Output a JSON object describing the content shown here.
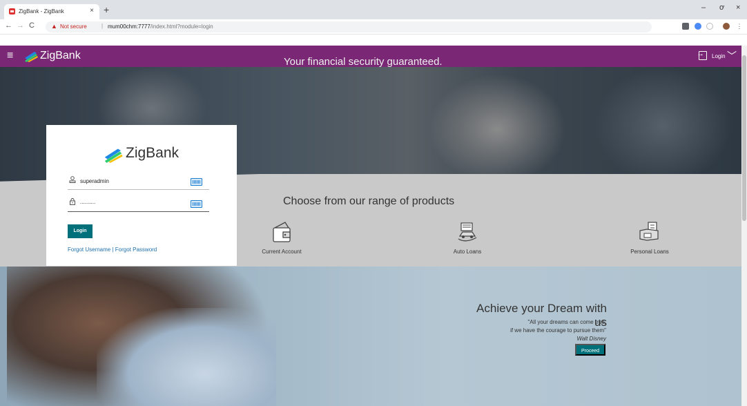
{
  "browser": {
    "tab_title": "ZigBank - ZigBank",
    "tab_close": "×",
    "new_tab": "+",
    "security_label": "Not secure",
    "url_separator": "|",
    "url_host": "mum00chm:7777",
    "url_path": "/index.html?module=login",
    "window_minimize": "–",
    "window_maximize": "ơ",
    "window_close": "×"
  },
  "header": {
    "menu_icon": "≡",
    "brand": "ZigBank",
    "login_label": "Login",
    "chevron": "﹀"
  },
  "hero": {
    "tagline": "Your financial security guaranteed."
  },
  "products": {
    "title": "Choose from our range of products",
    "items": [
      {
        "label": "Current Account",
        "icon": "wallet-icon"
      },
      {
        "label": "Auto Loans",
        "icon": "car-loan-icon"
      },
      {
        "label": "Personal Loans",
        "icon": "personal-loan-icon"
      }
    ]
  },
  "dream": {
    "title": "Achieve your Dream with us",
    "quote_line1": "\"All your dreams can come true,",
    "quote_line2": "if we have the courage to pursue them\"",
    "author": "Walt Disney",
    "proceed_label": "Proceed"
  },
  "login": {
    "brand": "ZigBank",
    "username_value": "superadmin",
    "password_value": "..........",
    "login_button": "Login",
    "forgot_username": "Forgot Username",
    "forgot_separator": " | ",
    "forgot_password": "Forgot Password"
  },
  "colors": {
    "header": "#7a2876",
    "teal_button": "#00707a",
    "link": "#1e6fa8"
  }
}
